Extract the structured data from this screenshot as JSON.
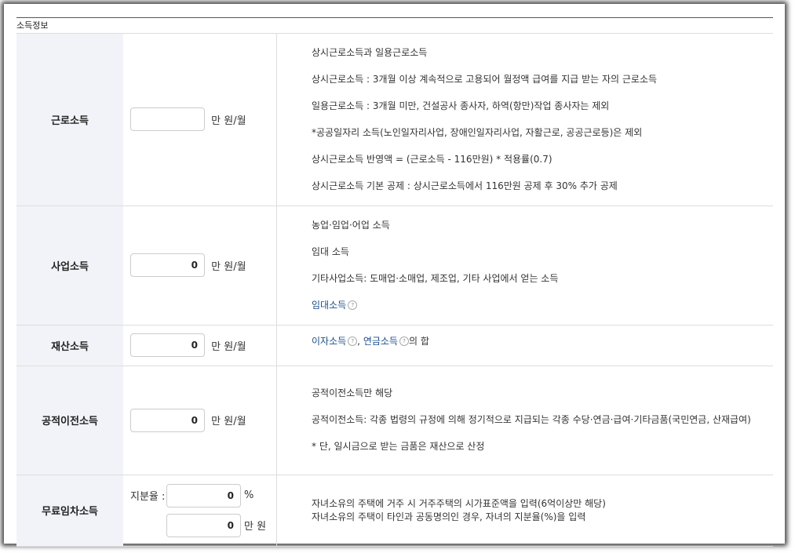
{
  "section_title": "소득정보",
  "rows": {
    "earned": {
      "label": "근로소득",
      "value": "",
      "unit": "만 원/월",
      "desc": [
        "상시근로소득과 일용근로소득",
        "상시근로소득 : 3개월 이상 계속적으로 고용되어 월정액 급여를 지급 받는 자의 근로소득",
        "일용근로소득 : 3개월 미만, 건설공사 종사자, 하역(항만)작업 종사자는 제외",
        "*공공일자리 소득(노인일자리사업, 장애인일자리사업, 자활근로, 공공근로등)은 제외",
        "상시근로소득 반영액 = (근로소득 - 116만원) * 적용률(0.7)",
        "상시근로소득 기본 공제 : 상시근로소득에서 116만원 공제 후 30% 추가 공제"
      ]
    },
    "business": {
      "label": "사업소득",
      "value": "0",
      "unit": "만 원/월",
      "desc": [
        "농업·임업·어업 소득",
        "임대 소득",
        "기타사업소득: 도매업·소매업, 제조업, 기타 사업에서 얻는 소득"
      ],
      "link": "임대소득",
      "tip": "?"
    },
    "property": {
      "label": "재산소득",
      "value": "0",
      "unit": "만 원/월",
      "link1": "이자소득",
      "sep": ", ",
      "link2": "연금소득",
      "suffix": "의 합",
      "tip": "?"
    },
    "transfer": {
      "label": "공적이전소득",
      "value": "0",
      "unit": "만 원/월",
      "desc": [
        "공적이전소득만 해당",
        "공적이전소득: 각종 법령의 규정에 의해 정기적으로 지급되는 각종 수당·연금·급여·기타금품(국민연금, 산재급여)",
        "* 단, 일시금으로 받는 금품은 재산으로 산정"
      ]
    },
    "rentfree": {
      "label": "무료임차소득",
      "share_label": "지분율 :",
      "share_value": "0",
      "share_unit": "%",
      "amount_value": "0",
      "amount_unit": "만 원",
      "desc": [
        "자녀소유의 주택에 거주 시 거주주택의 시가표준액을 입력(6억이상만 해당)",
        "자녀소유의 주택이 타인과 공동명의인 경우, 자녀의 지분율(%)을 입력"
      ]
    }
  }
}
